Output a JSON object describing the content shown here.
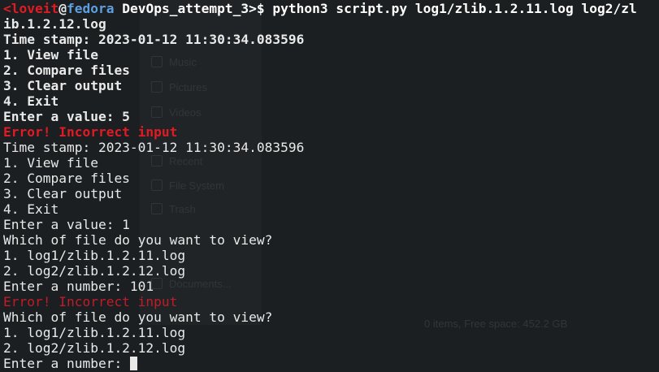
{
  "prompt": {
    "open_bracket": "<",
    "user": "loveit",
    "at": "@",
    "host": "fedora",
    "space": " ",
    "dir": "DevOps_attempt_3",
    "suffix": ">$ ",
    "command": "python3 script.py log1/zlib.1.2.11.log log2/zl",
    "command_wrap": "ib.1.2.12.log"
  },
  "lines": [
    "Time stamp: 2023-01-12 11:30:34.083596",
    "1. View file",
    "2. Compare files",
    "3. Clear output",
    "4. Exit",
    "Enter a value: 5",
    "Error! Incorrect input",
    "Time stamp: 2023-01-12 11:30:34.083596",
    "1. View file",
    "2. Compare files",
    "3. Clear output",
    "4. Exit",
    "Enter a value: 1",
    "Which of file do you want to view?",
    "1. log1/zlib.1.2.11.log",
    "2. log2/zlib.1.2.12.log",
    "Enter a number: 101",
    "Error! Incorrect input",
    "Which of file do you want to view?",
    "1. log1/zlib.1.2.11.log",
    "2. log2/zlib.1.2.12.log",
    "Enter a number: "
  ],
  "background_window": {
    "items": [
      "Music",
      "Pictures",
      "Videos",
      "Recent",
      "File System",
      "Trash",
      "Documents..."
    ],
    "status": "0 items, Free space: 452.2 GB"
  },
  "colors": {
    "background": "#1b1f21",
    "foreground": "#e9e9e9",
    "error": "#e01b24",
    "host": "#5e9fe0"
  }
}
